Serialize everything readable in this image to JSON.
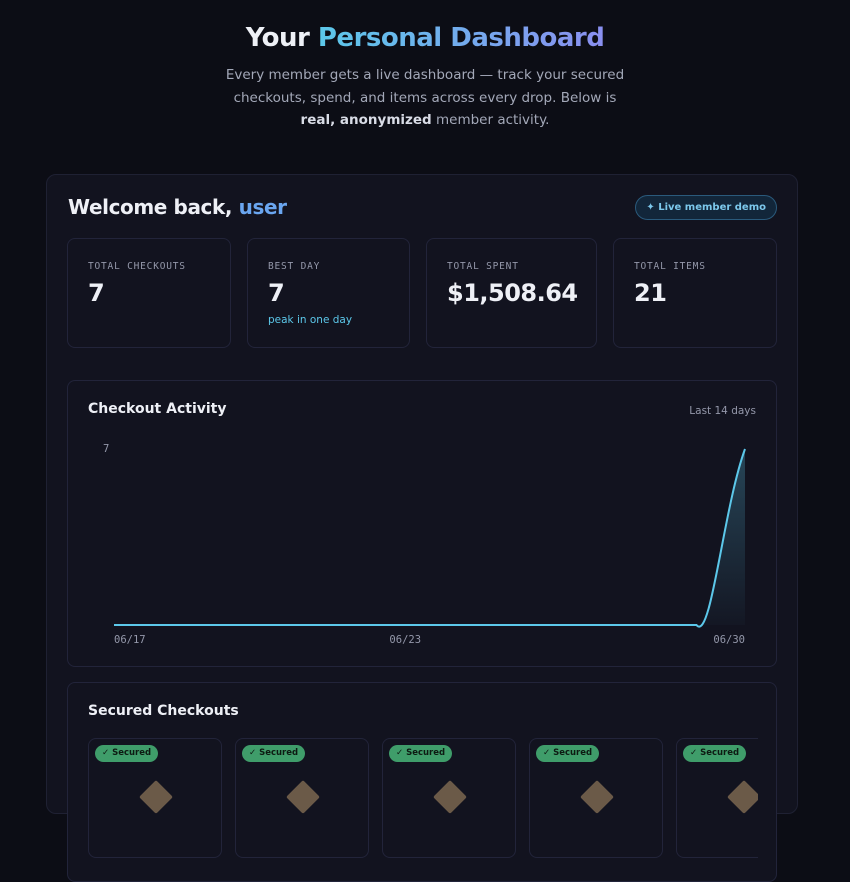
{
  "hero": {
    "title_plain": "Your ",
    "title_accent": "Personal Dashboard",
    "subtitle_1": "Every member gets a live dashboard — track your secured checkouts, spend, and items across every drop. Below is ",
    "subtitle_bold": "real, anonymized",
    "subtitle_2": " member activity."
  },
  "dashboard": {
    "welcome_prefix": "Welcome back, ",
    "username": "user",
    "badge": "✦ Live member demo",
    "stats": [
      {
        "label": "TOTAL CHECKOUTS",
        "value": "7"
      },
      {
        "label": "BEST DAY",
        "value": "7",
        "sub": "peak in one day"
      },
      {
        "label": "TOTAL SPENT",
        "value": "$1,508.64"
      },
      {
        "label": "TOTAL ITEMS",
        "value": "21"
      }
    ],
    "activity": {
      "title": "Checkout Activity",
      "range": "Last 14 days"
    },
    "secured": {
      "title": "Secured Checkouts",
      "tag": "✓ Secured"
    }
  },
  "chart_data": {
    "type": "area",
    "x": [
      "06/17",
      "06/18",
      "06/19",
      "06/20",
      "06/21",
      "06/22",
      "06/23",
      "06/24",
      "06/25",
      "06/26",
      "06/27",
      "06/28",
      "06/29",
      "06/30"
    ],
    "values": [
      0,
      0,
      0,
      0,
      0,
      0,
      0,
      0,
      0,
      0,
      0,
      0,
      0,
      7
    ],
    "x_tick_labels": [
      "06/17",
      "06/23",
      "06/30"
    ],
    "y_tick_labels": [
      "7"
    ],
    "ylim": [
      0,
      7
    ],
    "grid": false,
    "color": "#5cc8ea"
  },
  "colors": {
    "background": "#0c0d15",
    "card": "#12131f",
    "accent_cyan": "#5cc8ea",
    "accent_blue": "#6aa6f0",
    "secured_green": "#3f9d6a"
  }
}
